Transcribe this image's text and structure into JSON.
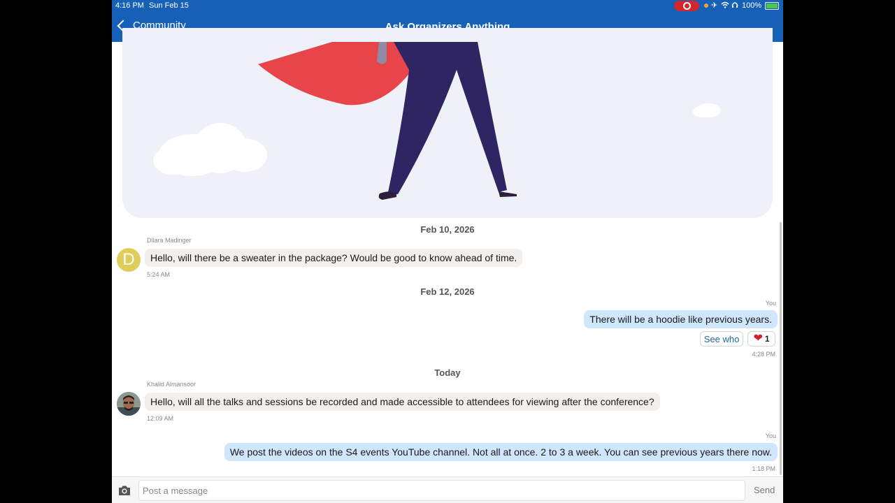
{
  "status_bar": {
    "time": "4:16 PM",
    "date": "Sun Feb 15",
    "battery": "100%",
    "icons": [
      "screen-record-icon",
      "airplane-icon",
      "wifi-icon",
      "headphones-icon",
      "battery-charging-icon"
    ]
  },
  "nav": {
    "back_label": "Community",
    "title": "Ask Organizers Anything"
  },
  "messages": [
    {
      "date_divider": "Feb 10, 2026"
    },
    {
      "sender": "Dilara Madinger",
      "avatar_letter": "D",
      "text": "Hello, will there be a sweater in the package? Would be good to know ahead of time.",
      "time": "5:24 AM"
    },
    {
      "date_divider": "Feb 12, 2026"
    },
    {
      "sender": "You",
      "text": "There will be a hoodie like previous years.",
      "time": "4:28 PM",
      "reaction": {
        "see_who_label": "See who",
        "emoji": "❤️",
        "count": "1"
      }
    },
    {
      "date_divider": "Today"
    },
    {
      "sender": "Khalid Almansoor",
      "text": "Hello, will all the talks and sessions be recorded and made accessible to attendees for viewing after the conference?",
      "time": "12:09 AM"
    },
    {
      "sender": "You",
      "text": "We post the videos on the S4 events YouTube channel. Not all at once. 2 to 3 a week. You can see previous years there now.",
      "time": "1:18 PM"
    }
  ],
  "composer": {
    "placeholder": "Post a message",
    "send_label": "Send"
  },
  "colors": {
    "nav_bg": "#1760b8",
    "outgoing_bubble": "#cfe6fb",
    "incoming_bubble": "#f3efed",
    "reaction_heart": "#d31f2b"
  }
}
